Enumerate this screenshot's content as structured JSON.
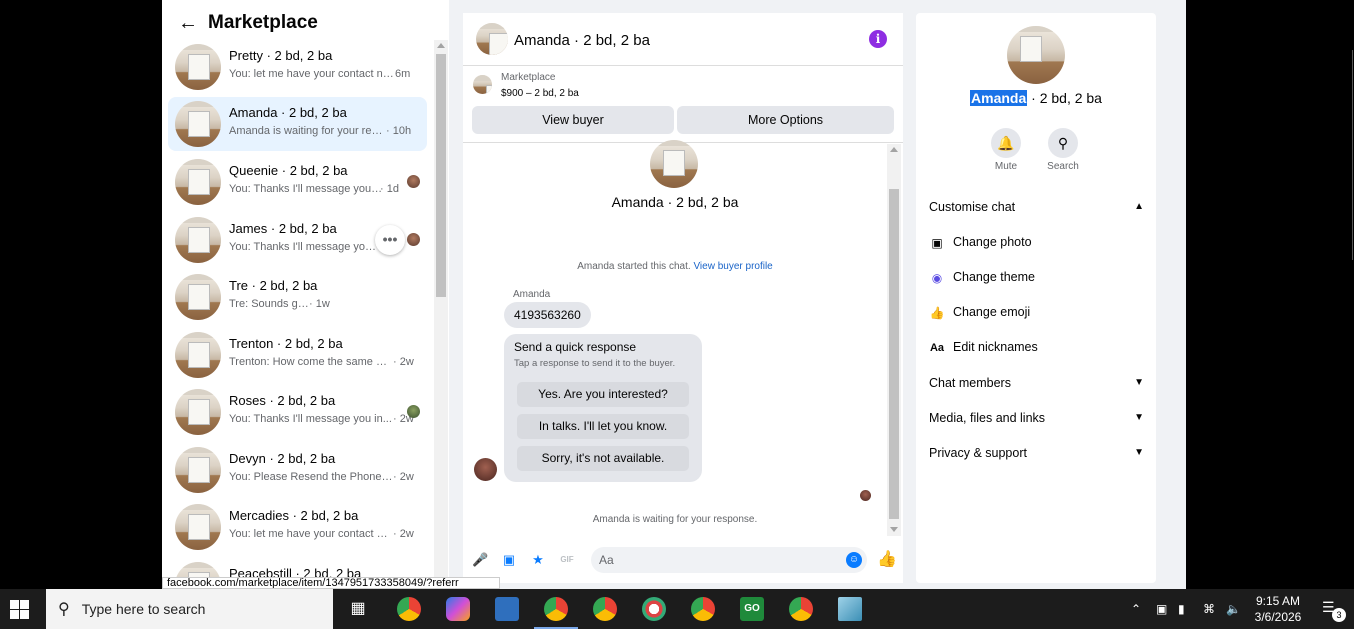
{
  "left": {
    "title": "Marketplace",
    "items": [
      {
        "name": "Pretty · 2 bd, 2 ba",
        "snippet": "You: let me have your contact nu...",
        "time": "6m"
      },
      {
        "name": "Amanda · 2 bd, 2 ba",
        "snippet": "Amanda is waiting for your resp...",
        "time": "· 10h"
      },
      {
        "name": "Queenie · 2 bd, 2 ba",
        "snippet": "You: Thanks I'll message you in ...",
        "time": "· 1d"
      },
      {
        "name": "James · 2 bd, 2 ba",
        "snippet": "You: Thanks I'll message you in...",
        "time": ""
      },
      {
        "name": "Tre · 2 bd, 2 ba",
        "snippet": "Tre: Sounds good",
        "time": "· 1w"
      },
      {
        "name": "Trenton · 2 bd, 2 ba",
        "snippet": "Trenton: How come the same add...",
        "time": "· 2w"
      },
      {
        "name": "Roses · 2 bd, 2 ba",
        "snippet": "You: Thanks I'll message you in...",
        "time": "· 2w"
      },
      {
        "name": "Devyn · 2 bd, 2 ba",
        "snippet": "You: Please Resend the Phone nu...",
        "time": "· 2w"
      },
      {
        "name": "Mercadies · 2 bd, 2 ba",
        "snippet": "You: let me have your contact nu...",
        "time": "· 2w"
      },
      {
        "name": "Peacebstill · 2 bd, 2 ba",
        "snippet": "",
        "time": ""
      }
    ]
  },
  "status_link": "facebook.com/marketplace/item/1347951733358049/?referr",
  "chat": {
    "header_title": "Amanda · 2 bd, 2 ba",
    "info_icon": "i",
    "marketplace_label": "Marketplace",
    "price_line": "$900 – 2 bd, 2 ba",
    "view_buyer": "View buyer",
    "more_options": "More Options",
    "thread_title": "Amanda · 2 bd, 2 ba",
    "started_text": "Amanda started this chat.",
    "buyer_profile_link": "View buyer profile",
    "sender": "Amanda",
    "message": "4193563260",
    "quick_title": "Send a quick response",
    "quick_sub": "Tap a response to send it to the buyer.",
    "quick_options": [
      "Yes. Are you interested?",
      "In talks. I'll let you know.",
      "Sorry, it's not available."
    ],
    "waiting": "Amanda is waiting for your response.",
    "input_placeholder": "Aa"
  },
  "panel": {
    "title_highlight": "Amanda",
    "title_rest": " · 2 bd, 2 ba",
    "mute": "Mute",
    "search": "Search",
    "customise": "Customise chat",
    "change_photo": "Change photo",
    "change_theme": "Change theme",
    "change_emoji": "Change emoji",
    "edit_nicknames": "Edit nicknames",
    "chat_members": "Chat members",
    "media": "Media, files and links",
    "privacy": "Privacy & support"
  },
  "taskbar": {
    "search_text": "Type here to search",
    "time": "9:15 AM",
    "date": "3/6/2026",
    "notifications": "3"
  },
  "colors": {
    "accent": "#0a7cff",
    "theme": "#8e2de2",
    "active_row": "#e7f3ff"
  }
}
